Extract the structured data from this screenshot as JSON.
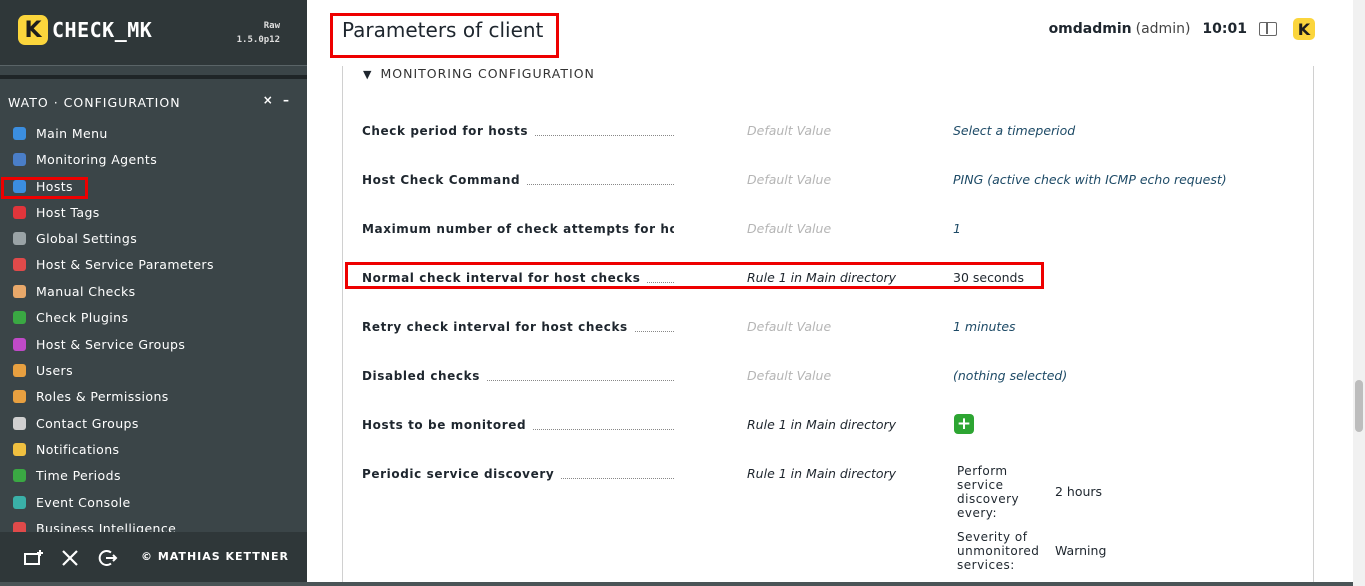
{
  "brand": {
    "logo_letter": "K",
    "logo_text": "CHECK_MK",
    "edition_line1": "Raw",
    "edition_line2": "1.5.0p12"
  },
  "sidebar": {
    "snapin_title": "WATO · CONFIGURATION",
    "controls": {
      "close": "×",
      "minimize": "–"
    },
    "items": [
      {
        "label": "Main Menu",
        "icon": "main-menu-icon",
        "color": "#3b8ee0"
      },
      {
        "label": "Monitoring Agents",
        "icon": "agents-icon",
        "color": "#4a7ec8"
      },
      {
        "label": "Hosts",
        "icon": "hosts-icon",
        "color": "#3b8ee0"
      },
      {
        "label": "Host Tags",
        "icon": "tags-icon",
        "color": "#e0353b"
      },
      {
        "label": "Global Settings",
        "icon": "gear-icon",
        "color": "#9aa3a6"
      },
      {
        "label": "Host & Service Parameters",
        "icon": "rules-icon",
        "color": "#e04a4a"
      },
      {
        "label": "Manual Checks",
        "icon": "hand-icon",
        "color": "#e8a86a"
      },
      {
        "label": "Check Plugins",
        "icon": "puzzle-icon",
        "color": "#3aa843"
      },
      {
        "label": "Host & Service Groups",
        "icon": "groups-icon",
        "color": "#c04ac8"
      },
      {
        "label": "Users",
        "icon": "users-icon",
        "color": "#e8a040"
      },
      {
        "label": "Roles & Permissions",
        "icon": "roles-icon",
        "color": "#e8a040"
      },
      {
        "label": "Contact Groups",
        "icon": "contact-groups-icon",
        "color": "#d0d0d0"
      },
      {
        "label": "Notifications",
        "icon": "bell-icon",
        "color": "#f0c040"
      },
      {
        "label": "Time Periods",
        "icon": "clock-icon",
        "color": "#3aa843"
      },
      {
        "label": "Event Console",
        "icon": "event-console-icon",
        "color": "#3ab0a8"
      },
      {
        "label": "Business Intelligence",
        "icon": "bi-icon",
        "color": "#e04a4a"
      }
    ],
    "footer": {
      "copyright": "© MATHIAS KETTNER"
    }
  },
  "header": {
    "title": "Parameters of client",
    "user": "omdadmin",
    "role": "(admin)",
    "time": "10:01",
    "logo_letter": "K"
  },
  "section": {
    "toggle": "▼",
    "title": "MONITORING CONFIGURATION",
    "rows": [
      {
        "label": "Check period for hosts",
        "source": "Default Value",
        "value": "Select a timeperiod"
      },
      {
        "label": "Host Check Command",
        "source": "Default Value",
        "value": "PING (active check with ICMP echo request)"
      },
      {
        "label": "Maximum number of check attempts for host",
        "source": "Default Value",
        "value": "1"
      },
      {
        "label": "Normal check interval for host checks",
        "source": "Rule 1 in Main directory",
        "value": "30 seconds"
      },
      {
        "label": "Retry check interval for host checks",
        "source": "Default Value",
        "value": "1 minutes"
      },
      {
        "label": "Disabled checks",
        "source": "Default Value",
        "value": "(nothing selected)"
      },
      {
        "label": "Hosts to be monitored",
        "source": "Rule 1 in Main directory",
        "value": ""
      },
      {
        "label": "Periodic service discovery",
        "source": "Rule 1 in Main directory",
        "value": ""
      }
    ],
    "discovery": {
      "interval_label_1": "Perform",
      "interval_label_2": "service",
      "interval_label_3": "discovery",
      "interval_label_4": "every:",
      "interval_value": "2 hours",
      "severity_label_1": "Severity of",
      "severity_label_2": "unmonitored",
      "severity_label_3": "services:",
      "severity_value": "Warning"
    }
  }
}
